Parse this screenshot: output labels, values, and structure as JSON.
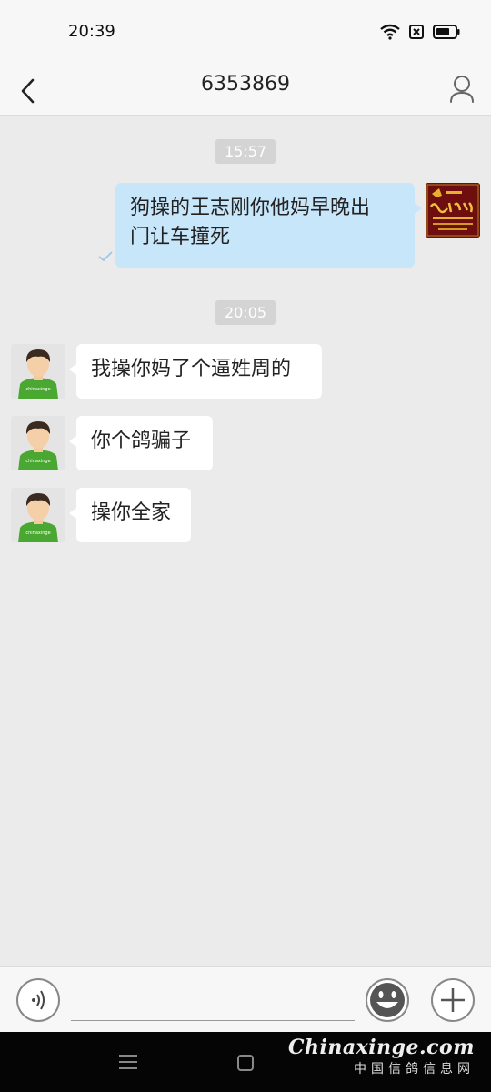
{
  "status_bar": {
    "time": "20:39",
    "wifi_icon": "wifi-icon",
    "sim_icon": "sim-off-icon",
    "battery_icon": "battery-icon"
  },
  "header": {
    "title": "6353869",
    "back_icon": "back-arrow-icon",
    "profile_icon": "user-profile-icon"
  },
  "messages": [
    {
      "type": "time",
      "text": "15:57"
    },
    {
      "type": "outgoing",
      "text_line1": "狗操的王志刚你他妈早晚出",
      "text_line2": "门让车撞死",
      "status_icon": "sent-check-icon"
    },
    {
      "type": "time",
      "text": "20:05"
    },
    {
      "type": "incoming",
      "text": "我操你妈了个逼姓周的"
    },
    {
      "type": "incoming",
      "text": "你个鸽骗子"
    },
    {
      "type": "incoming",
      "text": "操你全家"
    }
  ],
  "avatar_shirt_text": "chinaxinge",
  "input_bar": {
    "voice_icon": "voice-icon",
    "emoji_icon": "emoji-icon",
    "add_icon": "plus-icon",
    "value": ""
  },
  "nav_bar": {
    "menu_icon": "menu-icon",
    "home_icon": "home-square-icon"
  },
  "watermark": {
    "line1": "Chinaxinge.com",
    "line2": "中国信鸽信息网"
  },
  "colors": {
    "outgoing_bubble": "#c8e6fa",
    "incoming_bubble": "#ffffff",
    "chat_bg": "#ebebeb",
    "avatar_shirt": "#4aa832"
  }
}
